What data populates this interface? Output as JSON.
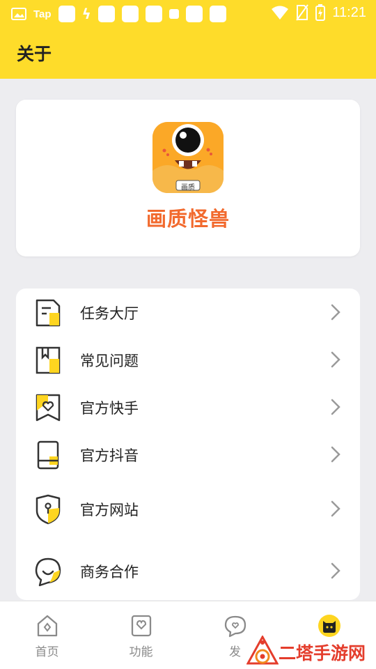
{
  "status_bar": {
    "tap_label": "Tap",
    "time": "11:21"
  },
  "header": {
    "title": "关于"
  },
  "app": {
    "name": "画质怪兽",
    "icon_badge": "画质",
    "brand_color": "#f26a2e",
    "accent_color": "#fedc2a"
  },
  "menu": {
    "items": [
      {
        "label": "任务大厅",
        "icon": "task-hall-icon"
      },
      {
        "label": "常见问题",
        "icon": "faq-book-icon"
      },
      {
        "label": "官方快手",
        "icon": "kuaishou-icon"
      },
      {
        "label": "官方抖音",
        "icon": "douyin-icon"
      },
      {
        "label": "官方网站",
        "icon": "website-shield-icon"
      },
      {
        "label": "商务合作",
        "icon": "chat-cooperation-icon"
      }
    ]
  },
  "bottom_nav": {
    "items": [
      {
        "label": "首页",
        "icon": "home-icon"
      },
      {
        "label": "功能",
        "icon": "features-icon"
      },
      {
        "label": "发",
        "icon": "discover-icon"
      },
      {
        "label": "",
        "icon": "cat-profile-icon"
      }
    ]
  },
  "watermark": {
    "text": "二塔手游网"
  }
}
